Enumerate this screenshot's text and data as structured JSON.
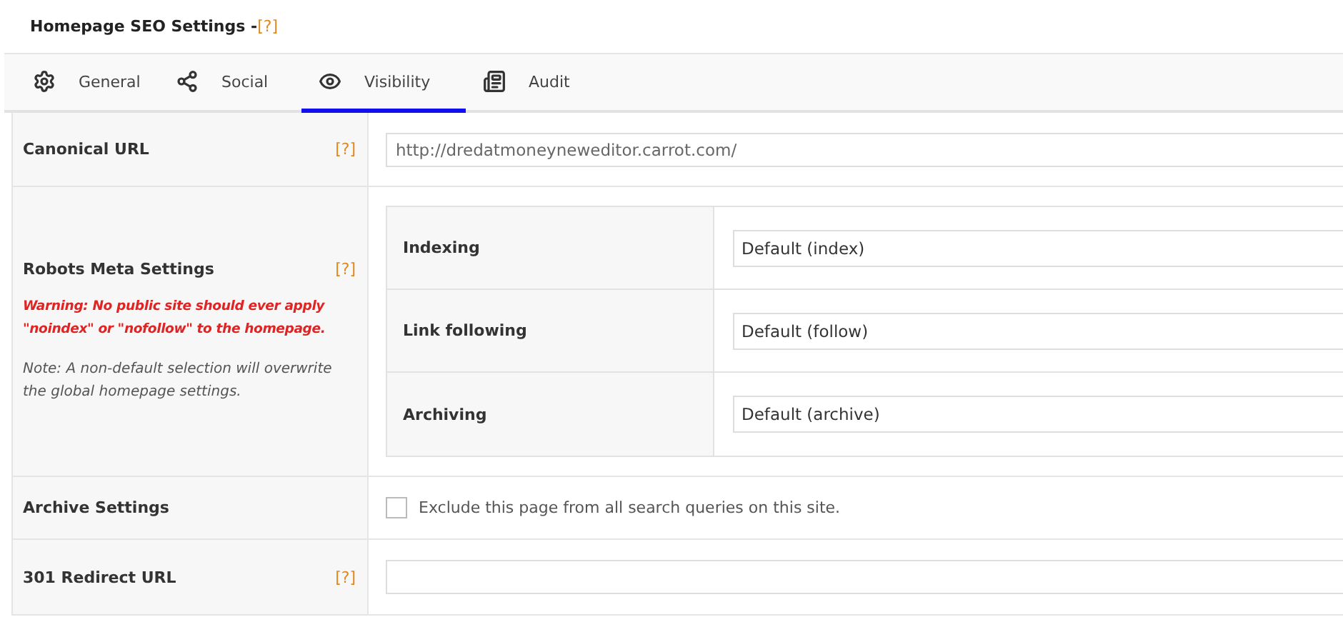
{
  "title": "Homepage SEO Settings - ",
  "title_help": "[?]",
  "tabs": [
    {
      "label": "General",
      "selected": false
    },
    {
      "label": "Social",
      "selected": false
    },
    {
      "label": "Visibility",
      "selected": true
    },
    {
      "label": "Audit",
      "selected": false
    }
  ],
  "canonical": {
    "label": "Canonical URL",
    "help": "[?]",
    "value": "http://dredatmoneyneweditor.carrot.com/"
  },
  "robots": {
    "label": "Robots Meta Settings",
    "help": "[?]",
    "warning": "Warning: No public site should ever apply \"noindex\" or \"nofollow\" to the homepage.",
    "note": "Note: A non-default selection will overwrite the global homepage settings.",
    "settings": [
      {
        "label": "Indexing",
        "value": "Default (index)"
      },
      {
        "label": "Link following",
        "value": "Default (follow)"
      },
      {
        "label": "Archiving",
        "value": "Default (archive)"
      }
    ]
  },
  "archive": {
    "label": "Archive Settings",
    "checkbox_label": "Exclude this page from all search queries on this site.",
    "checked": false
  },
  "redirect": {
    "label": "301 Redirect URL",
    "help": "[?]"
  }
}
